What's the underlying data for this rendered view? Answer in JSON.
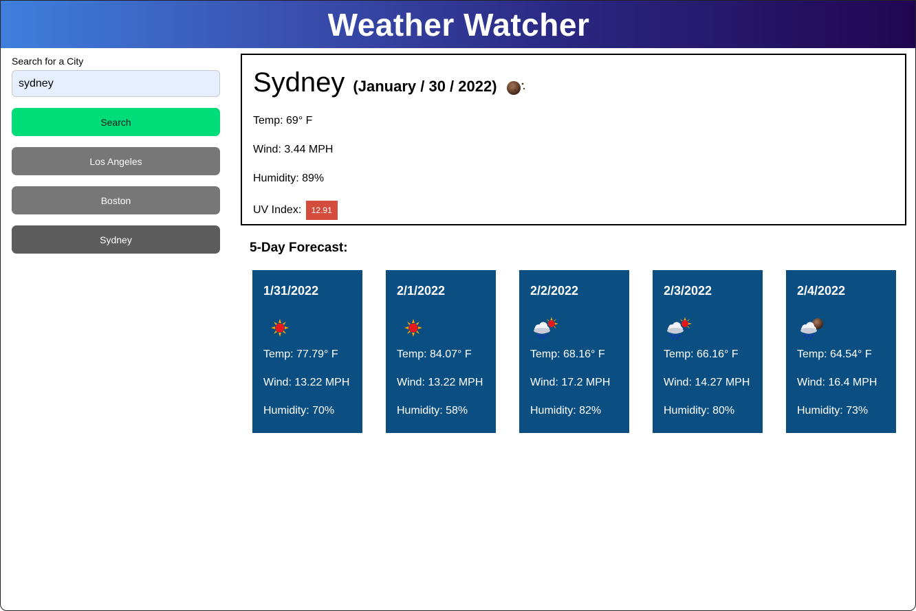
{
  "header": {
    "title": "Weather Watcher"
  },
  "sidebar": {
    "search_label": "Search for a City",
    "search_value": "sydney",
    "search_button": "Search",
    "history": [
      {
        "label": "Los Angeles"
      },
      {
        "label": "Boston"
      },
      {
        "label": "Sydney"
      }
    ]
  },
  "current": {
    "city": "Sydney",
    "date": "(January / 30 / 2022)",
    "icon": "moon-icon",
    "temp": "Temp: 69° F",
    "wind": "Wind: 3.44 MPH",
    "humidity": "Humidity: 89%",
    "uv_label": "UV Index:",
    "uv_value": "12.91",
    "uv_color": "#d34c3c"
  },
  "forecast": {
    "title": "5-Day Forecast:",
    "card_color": "#0b4f82",
    "days": [
      {
        "date": "1/31/2022",
        "icon": "sun-icon",
        "temp": "Temp: 77.79° F",
        "wind": "Wind: 13.22 MPH",
        "humidity": "Humidity: 70%"
      },
      {
        "date": "2/1/2022",
        "icon": "sun-icon",
        "temp": "Temp: 84.07° F",
        "wind": "Wind: 13.22 MPH",
        "humidity": "Humidity: 58%"
      },
      {
        "date": "2/2/2022",
        "icon": "rain-sun-icon",
        "temp": "Temp: 68.16° F",
        "wind": "Wind: 17.2 MPH",
        "humidity": "Humidity: 82%"
      },
      {
        "date": "2/3/2022",
        "icon": "rain-sun-icon",
        "temp": "Temp: 66.16° F",
        "wind": "Wind: 14.27 MPH",
        "humidity": "Humidity: 80%"
      },
      {
        "date": "2/4/2022",
        "icon": "rain-moon-icon",
        "temp": "Temp: 64.54° F",
        "wind": "Wind: 16.4 MPH",
        "humidity": "Humidity: 73%"
      }
    ]
  }
}
